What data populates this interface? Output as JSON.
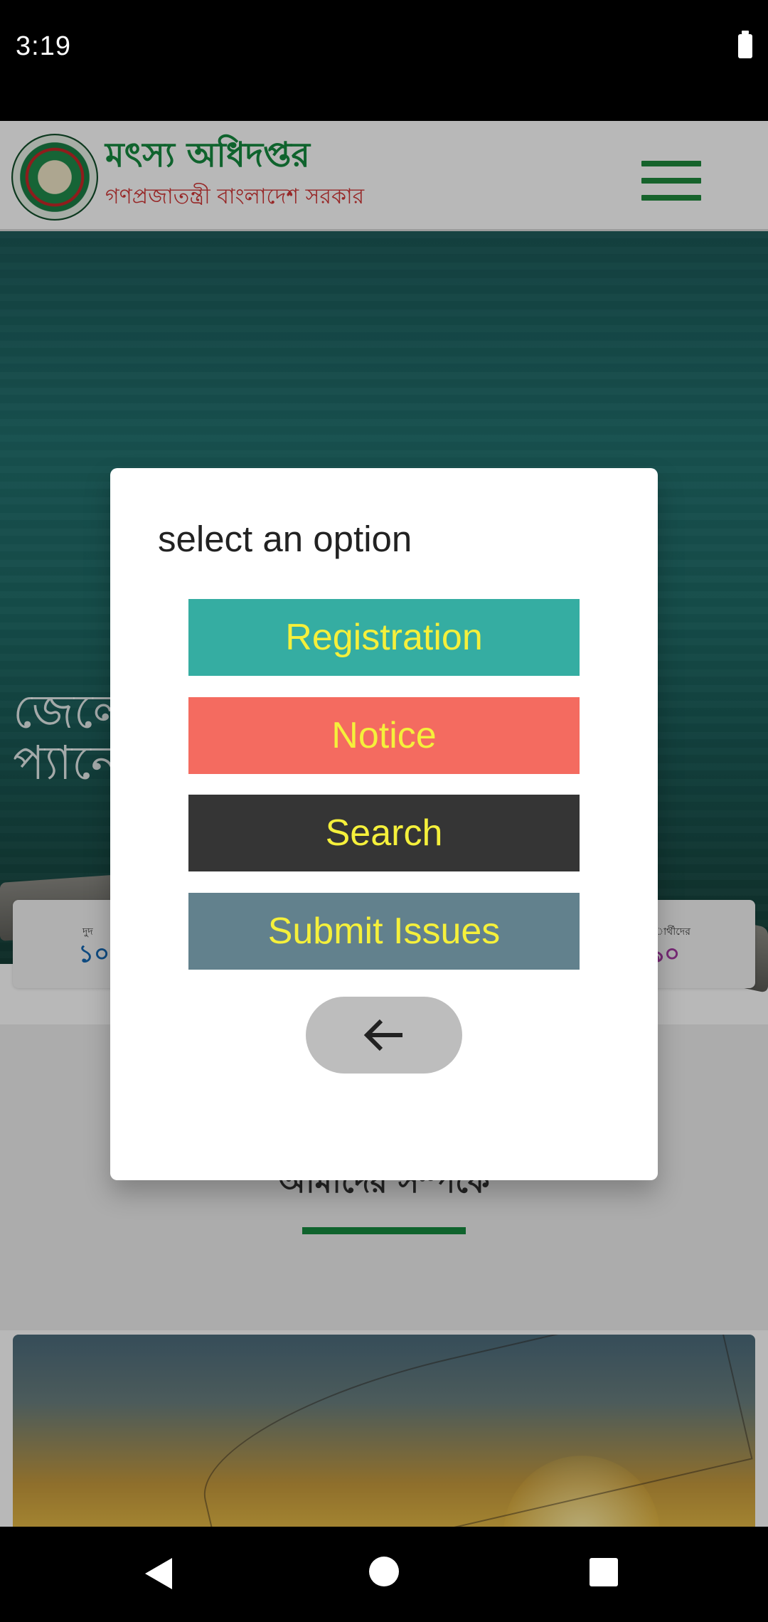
{
  "status_bar": {
    "time": "3:19"
  },
  "header": {
    "org_title": "মৎস্য অধিদপ্তর",
    "org_subtitle": "গণপ্রজাতন্ত্রী বাংলাদেশ সরকার",
    "logo_icon": "department-seal-icon",
    "menu_icon": "hamburger-menu-icon"
  },
  "hero": {
    "text": "জেলে\nপ্যানেল"
  },
  "stats": {
    "left_label": "দুদ",
    "left_value": "১০",
    "right_label": "ার্থীদের",
    "right_value": "৯০"
  },
  "section": {
    "title": "আমাদের সম্পর্কে"
  },
  "dialog": {
    "title": "select an option",
    "options": [
      {
        "label": "Registration",
        "color": "#35ada2"
      },
      {
        "label": "Notice",
        "color": "#f46b60"
      },
      {
        "label": "Search",
        "color": "#353535"
      },
      {
        "label": "Submit Issues",
        "color": "#62818d"
      }
    ],
    "text_color": "#f5f03b",
    "back_icon": "arrow-left-icon"
  },
  "system_nav": {
    "back_icon": "back-icon",
    "home_icon": "home-icon",
    "recents_icon": "recents-icon"
  }
}
